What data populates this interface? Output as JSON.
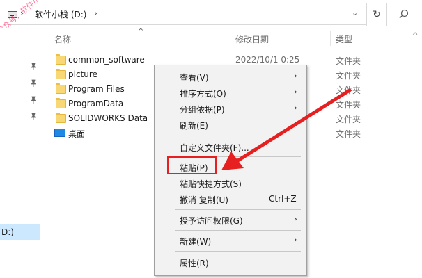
{
  "address_bar": {
    "crumbs": [
      "软件小栈 (D:)"
    ],
    "sep": "›",
    "dropdown": "⌄",
    "refresh": "↻"
  },
  "watermark": "公众号：软件小栈",
  "columns": {
    "name": "名称",
    "date": "修改日期",
    "type": "类型"
  },
  "files": [
    {
      "name": "common_software",
      "date": "2022/10/1 0:25",
      "type": "文件夹",
      "icon": "folder"
    },
    {
      "name": "picture",
      "date": "",
      "type": "文件夹",
      "icon": "folder"
    },
    {
      "name": "Program Files",
      "date": "",
      "type": "文件夹",
      "icon": "folder"
    },
    {
      "name": "ProgramData",
      "date": "",
      "type": "文件夹",
      "icon": "folder"
    },
    {
      "name": "SOLIDWORKS Data",
      "date": "",
      "type": "文件夹",
      "icon": "folder"
    },
    {
      "name": "桌面",
      "date": "",
      "type": "文件夹",
      "icon": "desktop"
    }
  ],
  "nav": {
    "drive_label": "D:)"
  },
  "context_menu": {
    "view": "查看(V)",
    "sort": "排序方式(O)",
    "group": "分组依据(P)",
    "refresh": "刷新(E)",
    "customize": "自定义文件夹(F)...",
    "paste": "粘贴(P)",
    "paste_shortcut": "粘贴快捷方式(S)",
    "undo": "撤消 复制(U)",
    "undo_shortcut": "Ctrl+Z",
    "grant_access": "授予访问权限(G)",
    "new": "新建(W)",
    "properties": "属性(R)"
  },
  "colors": {
    "highlight": "#e62020",
    "selection": "#cce8ff"
  }
}
